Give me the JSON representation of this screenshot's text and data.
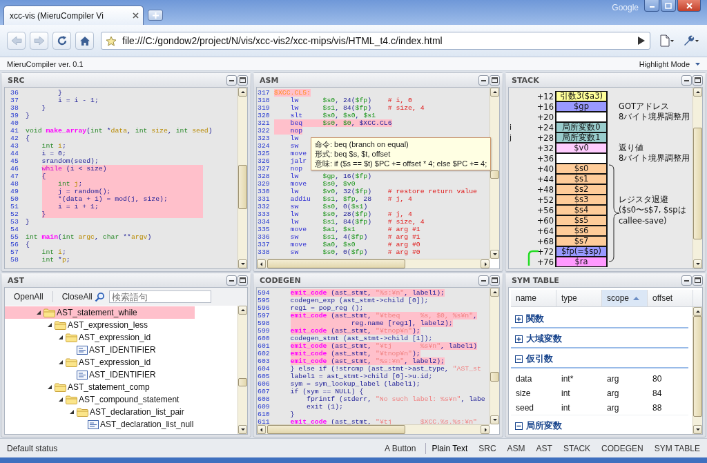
{
  "browser": {
    "tab_title": "xcc-vis (MieruCompiler Vi",
    "brand": "Google",
    "url": "file:///C:/gondow2/project/N/vis/xcc-vis2/xcc-mips/vis/HTML_t4.c/index.html"
  },
  "app": {
    "title": "MieruCompiler ver. 0.1",
    "mode_menu": "Highlight Mode"
  },
  "src": {
    "title": "SRC",
    "lines": [
      {
        "number": "36",
        "highlighted": false,
        "tokens": [
          {
            "kind": "p",
            "text": "        }"
          }
        ]
      },
      {
        "number": "37",
        "highlighted": false,
        "tokens": [
          {
            "kind": "p",
            "text": "        i = i - 1;"
          }
        ]
      },
      {
        "number": "38",
        "highlighted": false,
        "tokens": [
          {
            "kind": "p",
            "text": "    }"
          }
        ]
      },
      {
        "number": "39",
        "highlighted": false,
        "tokens": [
          {
            "kind": "p",
            "text": "}"
          }
        ]
      },
      {
        "number": "40",
        "highlighted": false
      },
      {
        "number": "41",
        "highlighted": false,
        "tokens": [
          {
            "kind": "ty",
            "text": "void "
          },
          {
            "kind": "fn",
            "text": "make_array"
          },
          {
            "kind": "p",
            "text": "("
          },
          {
            "kind": "ty",
            "text": "int "
          },
          {
            "kind": "p",
            "text": "*"
          },
          {
            "kind": "v",
            "text": "data"
          },
          {
            "kind": "p",
            "text": ", "
          },
          {
            "kind": "ty",
            "text": "int "
          },
          {
            "kind": "v",
            "text": "size"
          },
          {
            "kind": "p",
            "text": ", "
          },
          {
            "kind": "ty",
            "text": "int "
          },
          {
            "kind": "v",
            "text": "seed"
          },
          {
            "kind": "p",
            "text": ")"
          }
        ]
      },
      {
        "number": "42",
        "highlighted": false,
        "tokens": [
          {
            "kind": "p",
            "text": "{"
          }
        ]
      },
      {
        "number": "43",
        "highlighted": false,
        "tokens": [
          {
            "kind": "ty",
            "text": "    int "
          },
          {
            "kind": "v",
            "text": "i"
          },
          {
            "kind": "p",
            "text": ";"
          }
        ]
      },
      {
        "number": "44",
        "highlighted": false,
        "tokens": [
          {
            "kind": "p",
            "text": "    i = 0;"
          }
        ]
      },
      {
        "number": "45",
        "highlighted": false,
        "tokens": [
          {
            "kind": "p",
            "text": "    srandom(seed);"
          }
        ]
      },
      {
        "number": "46",
        "highlighted": true,
        "tokens": [
          {
            "kind": "kw",
            "text": "    while"
          },
          {
            "kind": "p",
            "text": " (i < size)"
          }
        ]
      },
      {
        "number": "47",
        "highlighted": true,
        "tokens": [
          {
            "kind": "p",
            "text": "    {"
          }
        ]
      },
      {
        "number": "48",
        "highlighted": true,
        "tokens": [
          {
            "kind": "ty",
            "text": "        int "
          },
          {
            "kind": "v",
            "text": "j"
          },
          {
            "kind": "p",
            "text": ";"
          }
        ]
      },
      {
        "number": "49",
        "highlighted": true,
        "tokens": [
          {
            "kind": "p",
            "text": "        j = random();"
          }
        ]
      },
      {
        "number": "50",
        "highlighted": true,
        "tokens": [
          {
            "kind": "p",
            "text": "        *(data + i) = mod(j, size);"
          }
        ]
      },
      {
        "number": "51",
        "highlighted": true,
        "tokens": [
          {
            "kind": "p",
            "text": "        i = i + 1;"
          }
        ]
      },
      {
        "number": "52",
        "highlighted": true,
        "tokens": [
          {
            "kind": "p",
            "text": "    }"
          }
        ]
      },
      {
        "number": "53",
        "highlighted": false,
        "tokens": [
          {
            "kind": "p",
            "text": "}"
          }
        ]
      },
      {
        "number": "54",
        "highlighted": false
      },
      {
        "number": "55",
        "highlighted": false,
        "tokens": [
          {
            "kind": "ty",
            "text": "int "
          },
          {
            "kind": "fn",
            "text": "main"
          },
          {
            "kind": "p",
            "text": "("
          },
          {
            "kind": "ty",
            "text": "int "
          },
          {
            "kind": "v",
            "text": "argc"
          },
          {
            "kind": "p",
            "text": ", "
          },
          {
            "kind": "ty",
            "text": "char "
          },
          {
            "kind": "p",
            "text": "**"
          },
          {
            "kind": "v",
            "text": "argv"
          },
          {
            "kind": "p",
            "text": ")"
          }
        ]
      },
      {
        "number": "56",
        "highlighted": false,
        "tokens": [
          {
            "kind": "p",
            "text": "{"
          }
        ]
      },
      {
        "number": "57",
        "highlighted": false,
        "tokens": [
          {
            "kind": "ty",
            "text": "    int "
          },
          {
            "kind": "v",
            "text": "i"
          },
          {
            "kind": "p",
            "text": ";"
          }
        ]
      },
      {
        "number": "58",
        "highlighted": false,
        "tokens": [
          {
            "kind": "ty",
            "text": "    int "
          },
          {
            "kind": "p",
            "text": "*"
          },
          {
            "kind": "v",
            "text": "p"
          },
          {
            "kind": "p",
            "text": ";"
          }
        ]
      }
    ]
  },
  "asm": {
    "title": "ASM",
    "lines": [
      {
        "number": "317",
        "highlighted": true,
        "tokens": [
          {
            "kind": "lbl",
            "text": "$XCC.CL5:"
          }
        ]
      },
      {
        "number": "318",
        "highlighted": false,
        "tokens": [
          {
            "kind": "op",
            "text": "    lw      "
          },
          {
            "kind": "reg",
            "text": "$s0"
          },
          {
            "kind": "p",
            "text": ", 24("
          },
          {
            "kind": "reg",
            "text": "$fp"
          },
          {
            "kind": "p",
            "text": ")    "
          },
          {
            "kind": "cm",
            "text": "# i, 0"
          }
        ]
      },
      {
        "number": "319",
        "highlighted": false,
        "tokens": [
          {
            "kind": "op",
            "text": "    lw      "
          },
          {
            "kind": "reg",
            "text": "$s1"
          },
          {
            "kind": "p",
            "text": ", 84("
          },
          {
            "kind": "reg",
            "text": "$fp"
          },
          {
            "kind": "p",
            "text": ")    "
          },
          {
            "kind": "cm",
            "text": "# size, 4"
          }
        ]
      },
      {
        "number": "320",
        "highlighted": false,
        "tokens": [
          {
            "kind": "op",
            "text": "    slt     "
          },
          {
            "kind": "reg",
            "text": "$s0"
          },
          {
            "kind": "p",
            "text": ", "
          },
          {
            "kind": "reg",
            "text": "$s0"
          },
          {
            "kind": "p",
            "text": ", "
          },
          {
            "kind": "reg",
            "text": "$s1"
          }
        ]
      },
      {
        "number": "321",
        "highlighted": true,
        "tokens": [
          {
            "kind": "op",
            "text": "    beq     "
          },
          {
            "kind": "reg",
            "text": "$s0"
          },
          {
            "kind": "p",
            "text": ", "
          },
          {
            "kind": "reg",
            "text": "$0"
          },
          {
            "kind": "p",
            "text": ", $XCC.CL6"
          }
        ]
      },
      {
        "number": "322",
        "highlighted": true,
        "tokens": [
          {
            "kind": "op",
            "text": "    nop"
          }
        ]
      },
      {
        "number": "323",
        "highlighted": false,
        "tokens": [
          {
            "kind": "op",
            "text": "    lw"
          }
        ]
      },
      {
        "number": "324",
        "highlighted": false,
        "tokens": [
          {
            "kind": "op",
            "text": "    sw"
          }
        ]
      },
      {
        "number": "325",
        "highlighted": false,
        "tokens": [
          {
            "kind": "op",
            "text": "    move"
          }
        ]
      },
      {
        "number": "326",
        "highlighted": false,
        "tokens": [
          {
            "kind": "op",
            "text": "    jalr"
          }
        ]
      },
      {
        "number": "327",
        "highlighted": false,
        "tokens": [
          {
            "kind": "op",
            "text": "    nop"
          }
        ]
      },
      {
        "number": "328",
        "highlighted": false,
        "tokens": [
          {
            "kind": "op",
            "text": "    lw      "
          },
          {
            "kind": "reg",
            "text": "$gp"
          },
          {
            "kind": "p",
            "text": ", 16("
          },
          {
            "kind": "reg",
            "text": "$fp"
          },
          {
            "kind": "p",
            "text": ")"
          }
        ]
      },
      {
        "number": "329",
        "highlighted": false,
        "tokens": [
          {
            "kind": "op",
            "text": "    move    "
          },
          {
            "kind": "reg",
            "text": "$s0"
          },
          {
            "kind": "p",
            "text": ", "
          },
          {
            "kind": "reg",
            "text": "$v0"
          }
        ]
      },
      {
        "number": "330",
        "highlighted": false,
        "tokens": [
          {
            "kind": "op",
            "text": "    lw      "
          },
          {
            "kind": "reg",
            "text": "$v0"
          },
          {
            "kind": "p",
            "text": ", 32("
          },
          {
            "kind": "reg",
            "text": "$fp"
          },
          {
            "kind": "p",
            "text": ")    "
          },
          {
            "kind": "cm",
            "text": "# restore return value"
          }
        ]
      },
      {
        "number": "331",
        "highlighted": false,
        "tokens": [
          {
            "kind": "op",
            "text": "    addiu   "
          },
          {
            "kind": "reg",
            "text": "$s1"
          },
          {
            "kind": "p",
            "text": ", "
          },
          {
            "kind": "reg",
            "text": "$fp"
          },
          {
            "kind": "p",
            "text": ", 28    "
          },
          {
            "kind": "cm",
            "text": "# j, 4"
          }
        ]
      },
      {
        "number": "332",
        "highlighted": false,
        "tokens": [
          {
            "kind": "op",
            "text": "    sw      "
          },
          {
            "kind": "reg",
            "text": "$s0"
          },
          {
            "kind": "p",
            "text": ", 0("
          },
          {
            "kind": "reg",
            "text": "$s1"
          },
          {
            "kind": "p",
            "text": ")"
          }
        ]
      },
      {
        "number": "333",
        "highlighted": false,
        "tokens": [
          {
            "kind": "op",
            "text": "    lw      "
          },
          {
            "kind": "reg",
            "text": "$s0"
          },
          {
            "kind": "p",
            "text": ", 28("
          },
          {
            "kind": "reg",
            "text": "$fp"
          },
          {
            "kind": "p",
            "text": ")    "
          },
          {
            "kind": "cm",
            "text": "# j, 4"
          }
        ]
      },
      {
        "number": "334",
        "highlighted": false,
        "tokens": [
          {
            "kind": "op",
            "text": "    lw      "
          },
          {
            "kind": "reg",
            "text": "$s1"
          },
          {
            "kind": "p",
            "text": ", 84("
          },
          {
            "kind": "reg",
            "text": "$fp"
          },
          {
            "kind": "p",
            "text": ")    "
          },
          {
            "kind": "cm",
            "text": "# size, 4"
          }
        ]
      },
      {
        "number": "335",
        "highlighted": false,
        "tokens": [
          {
            "kind": "op",
            "text": "    move    "
          },
          {
            "kind": "reg",
            "text": "$a1"
          },
          {
            "kind": "p",
            "text": ", "
          },
          {
            "kind": "reg",
            "text": "$s1"
          },
          {
            "kind": "cm",
            "text": "        # arg #1"
          }
        ]
      },
      {
        "number": "336",
        "highlighted": false,
        "tokens": [
          {
            "kind": "op",
            "text": "    sw      "
          },
          {
            "kind": "reg",
            "text": "$s1"
          },
          {
            "kind": "p",
            "text": ", 4("
          },
          {
            "kind": "reg",
            "text": "$fp"
          },
          {
            "kind": "p",
            "text": ")     "
          },
          {
            "kind": "cm",
            "text": "# arg #1"
          }
        ]
      },
      {
        "number": "337",
        "highlighted": false,
        "tokens": [
          {
            "kind": "op",
            "text": "    move    "
          },
          {
            "kind": "reg",
            "text": "$a0"
          },
          {
            "kind": "p",
            "text": ", "
          },
          {
            "kind": "reg",
            "text": "$s0"
          },
          {
            "kind": "cm",
            "text": "        # arg #0"
          }
        ]
      },
      {
        "number": "338",
        "highlighted": false,
        "tokens": [
          {
            "kind": "op",
            "text": "    sw      "
          },
          {
            "kind": "reg",
            "text": "$s0"
          },
          {
            "kind": "p",
            "text": ", 0("
          },
          {
            "kind": "reg",
            "text": "$fp"
          },
          {
            "kind": "p",
            "text": ")     "
          },
          {
            "kind": "cm",
            "text": "# arg #0"
          }
        ]
      }
    ],
    "tooltip": [
      "命令: beq (branch on equal)",
      "形式: beq $s, $t, offset",
      "意味: if ($s == $t) $PC += offset * 4; else $PC += 4;"
    ]
  },
  "stack": {
    "title": "STACK",
    "rows": [
      {
        "offset": "+12",
        "label": "引数3($a3)",
        "color": "#ffff99"
      },
      {
        "offset": "+16",
        "label": "$gp",
        "color": "#9999ff",
        "note": "GOTアドレス"
      },
      {
        "offset": "+20",
        "color": "#ffffff",
        "note": "8バイト境界調整用"
      },
      {
        "offset": "+24",
        "label": "局所変数0",
        "color": "#99cccc",
        "variable": "i"
      },
      {
        "offset": "+28",
        "label": "局所変数1",
        "color": "#99cccc",
        "variable": "j"
      },
      {
        "offset": "+32",
        "label": "$v0",
        "color": "#ffccff",
        "note": "返り値"
      },
      {
        "offset": "+36",
        "color": "#ffffff",
        "note": "8バイト境界調整用"
      },
      {
        "offset": "+40",
        "label": "$s0",
        "color": "#ffcc99"
      },
      {
        "offset": "+44",
        "label": "$s1",
        "color": "#ffcc99"
      },
      {
        "offset": "+48",
        "label": "$s2",
        "color": "#ffcc99"
      },
      {
        "offset": "+52",
        "label": "$s3",
        "color": "#ffcc99",
        "note": "レジスタ退避"
      },
      {
        "offset": "+56",
        "label": "$s4",
        "color": "#ffcc99",
        "note": "($s0〜s$7, $spは"
      },
      {
        "offset": "+60",
        "label": "$s5",
        "color": "#ffcc99",
        "note": "callee-save)"
      },
      {
        "offset": "+64",
        "label": "$s6",
        "color": "#ffcc99"
      },
      {
        "offset": "+68",
        "label": "$s7",
        "color": "#ffcc99"
      },
      {
        "offset": "+72",
        "label": "$fp(=$sp)",
        "color": "#9999ff"
      },
      {
        "offset": "+76",
        "label": "$ra",
        "color": "#ff99ff"
      }
    ]
  },
  "ast": {
    "title": "AST",
    "toolbar": {
      "open_all": "OpenAll",
      "close_all": "CloseAll",
      "search_placeholder": "検索語句"
    },
    "tree": [
      {
        "label": "AST_statement_while",
        "kind": "folder",
        "expanded": true,
        "selected": true,
        "children": [
          {
            "label": "AST_expression_less",
            "kind": "folder",
            "expanded": true,
            "selected": false,
            "children": [
              {
                "label": "AST_expression_id",
                "kind": "folder",
                "expanded": true,
                "selected": false,
                "children": [
                  {
                    "label": "AST_IDENTIFIER",
                    "kind": "leaf",
                    "selected": false
                  }
                ]
              },
              {
                "label": "AST_expression_id",
                "kind": "folder",
                "expanded": true,
                "selected": false,
                "children": [
                  {
                    "label": "AST_IDENTIFIER",
                    "kind": "leaf",
                    "selected": false
                  }
                ]
              }
            ]
          },
          {
            "label": "AST_statement_comp",
            "kind": "folder",
            "expanded": true,
            "selected": false,
            "children": [
              {
                "label": "AST_compound_statement",
                "kind": "folder",
                "expanded": true,
                "selected": false,
                "children": [
                  {
                    "label": "AST_declaration_list_pair",
                    "kind": "folder",
                    "expanded": true,
                    "selected": false,
                    "children": [
                      {
                        "label": "AST_declaration_list_null",
                        "kind": "leaf",
                        "selected": false
                      }
                    ]
                  }
                ]
              }
            ]
          }
        ]
      }
    ]
  },
  "codegen": {
    "title": "CODEGEN",
    "lines": [
      {
        "number": "594",
        "highlighted": true,
        "tokens": [
          {
            "kind": "fn",
            "text": "    emit_code"
          },
          {
            "kind": "p",
            "text": " (ast_stmt, "
          },
          {
            "kind": "str",
            "text": "\"%s:¥n\""
          },
          {
            "kind": "p",
            "text": ", label1);"
          }
        ]
      },
      {
        "number": "595",
        "highlighted": false,
        "tokens": [
          {
            "kind": "p",
            "text": "    codegen_exp (ast_stmt->child [0]);"
          }
        ]
      },
      {
        "number": "596",
        "highlighted": false,
        "tokens": [
          {
            "kind": "p",
            "text": "    reg1 = pop_reg ();"
          }
        ]
      },
      {
        "number": "597",
        "highlighted": true,
        "tokens": [
          {
            "kind": "fn",
            "text": "    emit_code"
          },
          {
            "kind": "p",
            "text": " (ast_stmt, "
          },
          {
            "kind": "str",
            "text": "\"¥tbeq     %s, $0, %s¥n\""
          },
          {
            "kind": "p",
            "text": ","
          }
        ]
      },
      {
        "number": "598",
        "highlighted": true,
        "tokens": [
          {
            "kind": "p",
            "text": "                   reg.name [reg1], label2);"
          }
        ]
      },
      {
        "number": "599",
        "highlighted": true,
        "tokens": [
          {
            "kind": "fn",
            "text": "    emit_code"
          },
          {
            "kind": "p",
            "text": " (ast_stmt, "
          },
          {
            "kind": "str",
            "text": "\"¥tnop¥n\""
          },
          {
            "kind": "p",
            "text": ");"
          }
        ]
      },
      {
        "number": "600",
        "highlighted": false,
        "tokens": [
          {
            "kind": "p",
            "text": "    codegen_stmt (ast_stmt->child [1]);"
          }
        ]
      },
      {
        "number": "601",
        "highlighted": true,
        "tokens": [
          {
            "kind": "fn",
            "text": "    emit_code"
          },
          {
            "kind": "p",
            "text": " (ast_stmt, "
          },
          {
            "kind": "str",
            "text": "\"¥tj       %s¥n\""
          },
          {
            "kind": "p",
            "text": ", label1)"
          }
        ]
      },
      {
        "number": "602",
        "highlighted": true,
        "tokens": [
          {
            "kind": "fn",
            "text": "    emit_code"
          },
          {
            "kind": "p",
            "text": " (ast_stmt, "
          },
          {
            "kind": "str",
            "text": "\"¥tnop¥n\""
          },
          {
            "kind": "p",
            "text": ");"
          }
        ]
      },
      {
        "number": "603",
        "highlighted": true,
        "tokens": [
          {
            "kind": "fn",
            "text": "    emit_code"
          },
          {
            "kind": "p",
            "text": " (ast_stmt, "
          },
          {
            "kind": "str",
            "text": "\"%s:¥n\""
          },
          {
            "kind": "p",
            "text": ", label2);"
          }
        ]
      },
      {
        "number": "604",
        "highlighted": false,
        "tokens": [
          {
            "kind": "p",
            "text": "    } else if (!strcmp (ast_stmt->ast_type, "
          },
          {
            "kind": "str",
            "text": "\"AST_st"
          }
        ]
      },
      {
        "number": "605",
        "highlighted": false,
        "tokens": [
          {
            "kind": "p",
            "text": "    label1 = ast_stmt->child [0]->u.id;"
          }
        ]
      },
      {
        "number": "606",
        "highlighted": false,
        "tokens": [
          {
            "kind": "p",
            "text": "    sym = sym_lookup_label (label1);"
          }
        ]
      },
      {
        "number": "607",
        "highlighted": false,
        "tokens": [
          {
            "kind": "p",
            "text": "    if (sym == NULL) {"
          }
        ]
      },
      {
        "number": "608",
        "highlighted": false,
        "tokens": [
          {
            "kind": "p",
            "text": "        fprintf (stderr, "
          },
          {
            "kind": "str",
            "text": "\"No such label: %s¥n\""
          },
          {
            "kind": "p",
            "text": ", labe"
          }
        ]
      },
      {
        "number": "609",
        "highlighted": false,
        "tokens": [
          {
            "kind": "p",
            "text": "        exit (1);"
          }
        ]
      },
      {
        "number": "610",
        "highlighted": false,
        "tokens": [
          {
            "kind": "p",
            "text": "    }"
          }
        ]
      },
      {
        "number": "611",
        "highlighted": false,
        "tokens": [
          {
            "kind": "fn",
            "text": "    emit_code"
          },
          {
            "kind": "p",
            "text": " (ast_stmt, "
          },
          {
            "kind": "str",
            "text": "\"¥tj       $XCC.%s.%s:¥n\""
          }
        ]
      }
    ]
  },
  "sym_table": {
    "title": "SYM TABLE",
    "columns": [
      {
        "label": "name",
        "sorted": false
      },
      {
        "label": "type",
        "sorted": false
      },
      {
        "label": "scope",
        "sorted": true
      },
      {
        "label": "offset",
        "sorted": false
      }
    ],
    "groups": [
      {
        "label": "関数",
        "expanded": false
      },
      {
        "label": "大域変数",
        "expanded": false
      },
      {
        "label": "仮引数",
        "expanded": true,
        "rows": [
          [
            "data",
            "int*",
            "arg",
            "80"
          ],
          [
            "size",
            "int",
            "arg",
            "84"
          ],
          [
            "seed",
            "int",
            "arg",
            "88"
          ]
        ]
      },
      {
        "label": "局所変数",
        "expanded": true
      }
    ]
  },
  "status_bar": {
    "message": "Default status",
    "button": "A Button",
    "text": "Plain Text",
    "panels": [
      "SRC",
      "ASM",
      "AST",
      "STACK",
      "CODEGEN",
      "SYM TABLE"
    ]
  }
}
